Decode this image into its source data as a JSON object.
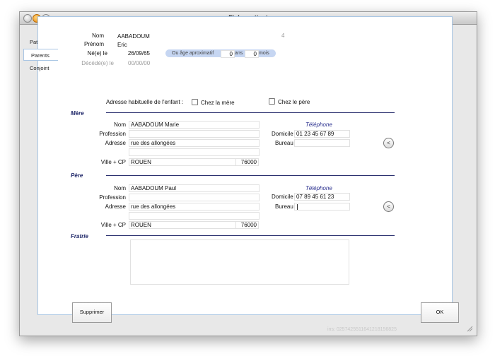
{
  "window": {
    "title": "Fiche patient"
  },
  "tabs": [
    {
      "label": "Patient"
    },
    {
      "label": "Parents"
    },
    {
      "label": "Conjoint"
    }
  ],
  "patient": {
    "nom_label": "Nom",
    "nom": "AABADOUM",
    "counter": "4",
    "prenom_label": "Prénom",
    "prenom": "Eric",
    "nee_label": "Né(e) le",
    "nee": "26/09/65",
    "age_label": "Ou âge aproximatif",
    "age_ans": "0",
    "ans_label": "ans",
    "age_mois": "0",
    "mois_label": "mois",
    "decede_label": "Décédé(e) le",
    "decede": "00/00/00"
  },
  "adresse": {
    "label": "Adresse habituelle de l'enfant :",
    "chez_mere": "Chez la mère",
    "chez_pere": "Chez le père"
  },
  "mere": {
    "section": "Mère",
    "nom_label": "Nom",
    "nom": "AABADOUM Marie",
    "profession_label": "Profession",
    "profession": "",
    "adresse_label": "Adresse",
    "adresse": "rue des allongées",
    "adresse2": "",
    "ville_label": "Ville + CP",
    "ville": "ROUEN",
    "cp": "76000",
    "telephone_label": "Téléphone",
    "domicile_label": "Domicile",
    "domicile": "01 23 45 67 89",
    "bureau_label": "Bureau",
    "bureau": "",
    "copy_glyph": "<"
  },
  "pere": {
    "section": "Père",
    "nom_label": "Nom",
    "nom": "AABADOUM Paul",
    "profession_label": "Profession",
    "profession": "",
    "adresse_label": "Adresse",
    "adresse": "rue des allongées",
    "adresse2": "",
    "ville_label": "Ville + CP",
    "ville": "ROUEN",
    "cp": "76000",
    "telephone_label": "Téléphone",
    "domicile_label": "Domicile",
    "domicile": "07 89 45 61 23",
    "bureau_label": "Bureau",
    "bureau": "",
    "copy_glyph": "<"
  },
  "fratrie": {
    "section": "Fratrie",
    "text": ""
  },
  "buttons": {
    "delete": "Supprimer",
    "ok": "OK"
  },
  "footer": {
    "ins": "ins: 0257425511641218156825"
  },
  "colors": {
    "accent": "#222a6b",
    "panel_border": "#a9c6e4",
    "age_pill": "#c6d6f2"
  }
}
